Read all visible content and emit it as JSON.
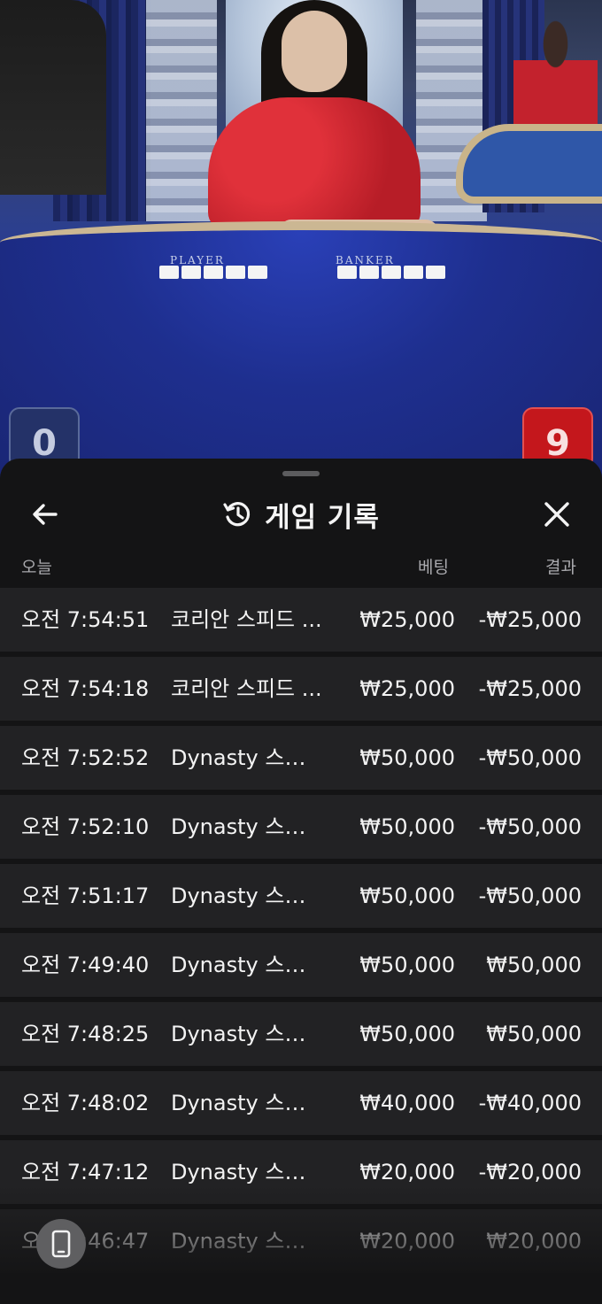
{
  "table": {
    "player_label": "PLAYER",
    "banker_label": "BANKER",
    "player_score": "0",
    "banker_score": "9"
  },
  "sheet": {
    "title": "게임 기록",
    "icons": {
      "back": "arrow-left-icon",
      "title": "history-icon",
      "close": "close-icon",
      "device": "phone-icon"
    },
    "columns": {
      "date": "오늘",
      "bet": "베팅",
      "result": "결과"
    },
    "rows": [
      {
        "time": "오전 7:54:51",
        "game": "코리안 스피드 ...",
        "bet": "₩25,000",
        "result": "-₩25,000"
      },
      {
        "time": "오전 7:54:18",
        "game": "코리안 스피드 ...",
        "bet": "₩25,000",
        "result": "-₩25,000"
      },
      {
        "time": "오전 7:52:52",
        "game": "Dynasty 스피...",
        "bet": "₩50,000",
        "result": "-₩50,000"
      },
      {
        "time": "오전 7:52:10",
        "game": "Dynasty 스피...",
        "bet": "₩50,000",
        "result": "-₩50,000"
      },
      {
        "time": "오전 7:51:17",
        "game": "Dynasty 스피...",
        "bet": "₩50,000",
        "result": "-₩50,000"
      },
      {
        "time": "오전 7:49:40",
        "game": "Dynasty 스피...",
        "bet": "₩50,000",
        "result": "₩50,000"
      },
      {
        "time": "오전 7:48:25",
        "game": "Dynasty 스피...",
        "bet": "₩50,000",
        "result": "₩50,000"
      },
      {
        "time": "오전 7:48:02",
        "game": "Dynasty 스피...",
        "bet": "₩40,000",
        "result": "-₩40,000"
      },
      {
        "time": "오전 7:47:12",
        "game": "Dynasty 스피...",
        "bet": "₩20,000",
        "result": "-₩20,000"
      },
      {
        "time": "오전 7:46:47",
        "game": "Dynasty 스피...",
        "bet": "₩20,000",
        "result": "₩20,000"
      }
    ]
  }
}
